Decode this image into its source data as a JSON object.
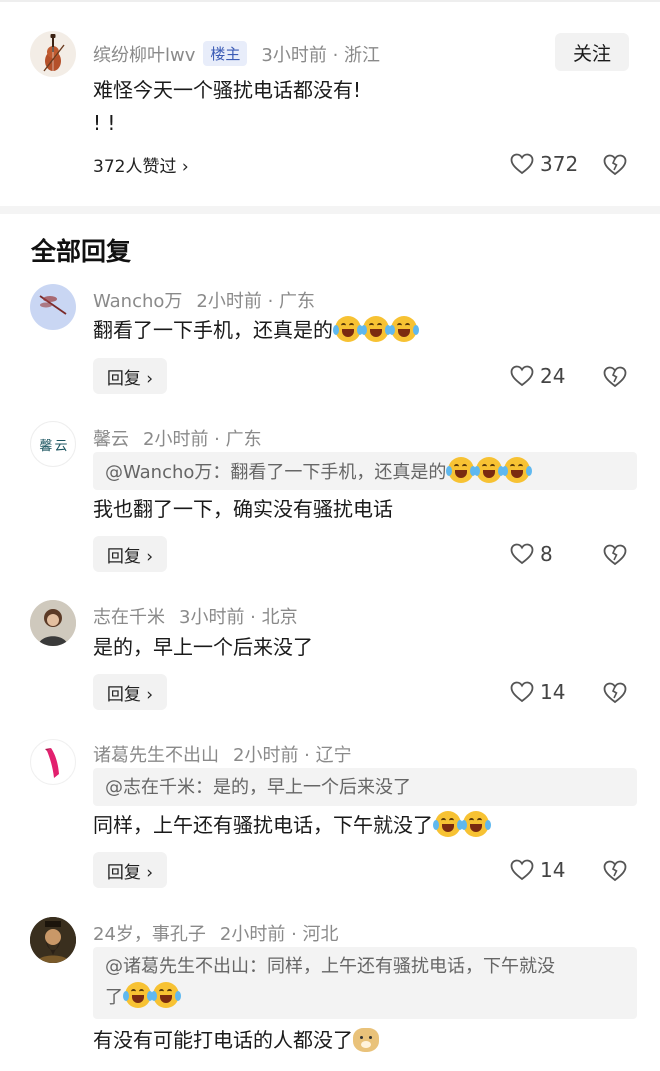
{
  "op": {
    "author": "缤纷柳叶lwv",
    "badge": "楼主",
    "time": "3小时前 · 浙江",
    "follow": "关注",
    "text_line1": "难怪今天一个骚扰电话都没有!",
    "text_line2": "! !",
    "likers": "372人赞过 ›",
    "like_count": "372"
  },
  "section_title": "全部回复",
  "reply_label": "回复 ›",
  "comments": [
    {
      "author": "Wancho万",
      "time": "2小时前 · 广东",
      "text": "翻看了一下手机，还真是的",
      "emojis": 3,
      "likes": "24"
    },
    {
      "author": "馨云",
      "time": "2小时前 · 广东",
      "quote": "@Wancho万：翻看了一下手机，还真是的",
      "quote_emojis": 3,
      "text": "我也翻了一下，确实没有骚扰电话",
      "likes": "8",
      "avatar_text": "馨 云"
    },
    {
      "author": "志在千米",
      "time": "3小时前 · 北京",
      "text": "是的，早上一个后来没了",
      "likes": "14"
    },
    {
      "author": "诸葛先生不出山",
      "time": "2小时前 · 辽宁",
      "quote": "@志在千米：是的，早上一个后来没了",
      "text": "同样，上午还有骚扰电话，下午就没了",
      "emojis": 2,
      "likes": "14"
    },
    {
      "author": "24岁，事孔子",
      "time": "2小时前 · 河北",
      "quote_line1": "@诸葛先生不出山：同样，上午还有骚扰电话，下午就没",
      "quote_line2": "了",
      "quote_emojis": 2,
      "text": "有没有可能打电话的人都没了"
    }
  ],
  "icons": {
    "like": "heart-outline-icon",
    "dislike": "broken-heart-icon"
  }
}
